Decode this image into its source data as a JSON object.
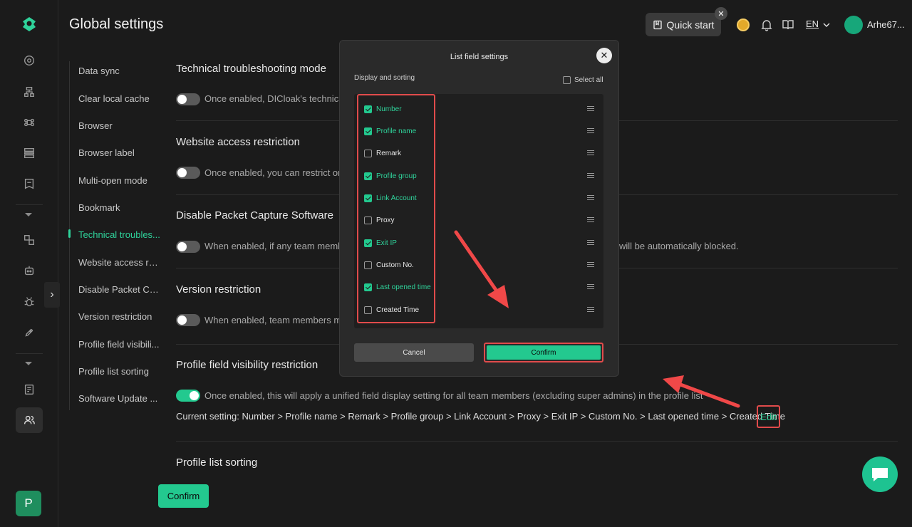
{
  "header": {
    "title": "Global settings",
    "quick_start": "Quick start",
    "language": "EN",
    "user_name": "Arhe67..."
  },
  "rail": {
    "workspace_initial": "P"
  },
  "nav": {
    "items": [
      "Data sync",
      "Clear local cache",
      "Browser",
      "Browser label",
      "Multi-open mode",
      "Bookmark",
      "Technical troubles...",
      "Website access re...",
      "Disable Packet Ca...",
      "Version restriction",
      "Profile field visibili...",
      "Profile list sorting",
      "Software Update ..."
    ],
    "active_index": 6
  },
  "sections": [
    {
      "title": "Technical troubleshooting mode",
      "enabled": false,
      "desc": "Once enabled, DICloak's technical"
    },
    {
      "title": "Website access restriction",
      "enabled": false,
      "desc": "Once enabled, you can restrict or p"
    },
    {
      "title": "Disable Packet Capture Software",
      "enabled": false,
      "desc": "When enabled, if any team membe",
      "desc_tail": "will be automatically blocked."
    },
    {
      "title": "Version restriction",
      "enabled": false,
      "desc": "When enabled, team members mu"
    },
    {
      "title": "Profile field visibility restriction",
      "enabled": true,
      "desc": "Once enabled, this will apply a unified field display setting for all team members (excluding super admins) in the profile list"
    },
    {
      "title": "Profile list sorting"
    }
  ],
  "current_setting": "Current setting: Number > Profile name > Remark > Profile group > Link Account > Proxy > Exit IP > Custom No. > Last opened time > Created Time",
  "edit_label": "Edit",
  "confirm_label": "Confirm",
  "modal": {
    "title": "List field settings",
    "subtitle": "Display and sorting",
    "select_all": "Select all",
    "fields": [
      {
        "label": "Number",
        "checked": true
      },
      {
        "label": "Profile name",
        "checked": true
      },
      {
        "label": "Remark",
        "checked": false
      },
      {
        "label": "Profile group",
        "checked": true
      },
      {
        "label": "Link Account",
        "checked": true
      },
      {
        "label": "Proxy",
        "checked": false
      },
      {
        "label": "Exit IP",
        "checked": true
      },
      {
        "label": "Custom No.",
        "checked": false
      },
      {
        "label": "Last opened time",
        "checked": true
      },
      {
        "label": "Created Time",
        "checked": false
      }
    ],
    "cancel": "Cancel",
    "confirm": "Confirm"
  },
  "colors": {
    "accent": "#23c98f",
    "highlight": "#e14b4b",
    "background": "#1b1b1b"
  }
}
